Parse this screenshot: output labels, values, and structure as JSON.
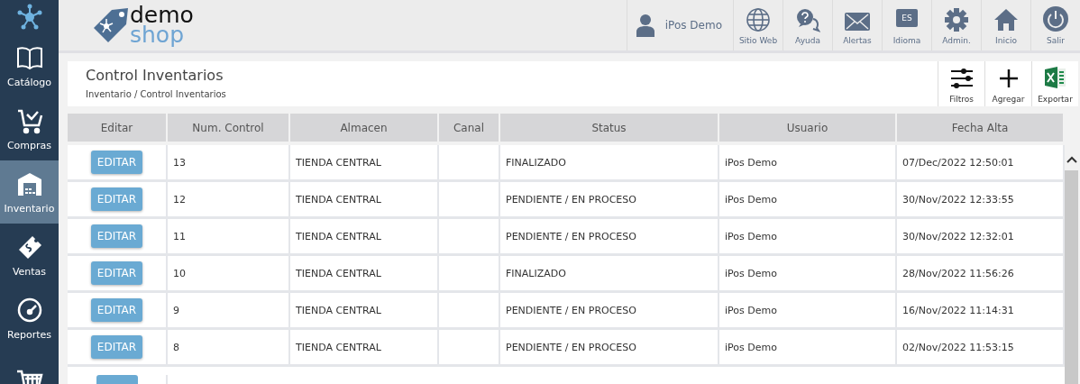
{
  "sidebar": {
    "items": [
      {
        "kind": "catalog",
        "label": "Catálogo",
        "selected": false
      },
      {
        "kind": "purchases",
        "label": "Compras",
        "selected": false
      },
      {
        "kind": "inventory",
        "label": "Inventario",
        "selected": true
      },
      {
        "kind": "sales",
        "label": "Ventas",
        "selected": false
      },
      {
        "kind": "reports",
        "label": "Reportes",
        "selected": false
      },
      {
        "kind": "cart",
        "selected": false
      }
    ]
  },
  "logo": {
    "word_1": "demo",
    "word_2": "shop"
  },
  "user": {
    "name": "iPos Demo"
  },
  "nav": [
    {
      "kind": "web",
      "label": "Sitio Web"
    },
    {
      "kind": "help",
      "label": "Ayuda"
    },
    {
      "kind": "alerts",
      "label": "Alertas"
    },
    {
      "kind": "language",
      "label": "Idioma",
      "badge": "ES"
    },
    {
      "kind": "admin",
      "label": "Admin."
    },
    {
      "kind": "home",
      "label": "Inicio"
    },
    {
      "kind": "exit",
      "label": "Salir"
    }
  ],
  "page": {
    "title": "Control Inventarios",
    "breadcrumb": "Inventario / Control Inventarios"
  },
  "actions": [
    {
      "kind": "filters",
      "label": "Filtros"
    },
    {
      "kind": "add",
      "label": "Agregar"
    },
    {
      "kind": "export",
      "label": "Exportar"
    }
  ],
  "table": {
    "columns": [
      "Editar",
      "Num. Control",
      "Almacen",
      "Canal",
      "Status",
      "Usuario",
      "Fecha Alta"
    ],
    "rows": [
      {
        "button": "EDITAR",
        "num": "13",
        "almacen": "TIENDA CENTRAL",
        "status": "FINALIZADO",
        "usuario": "iPos Demo",
        "fecha": "07/Dec/2022 12:50:01"
      },
      {
        "button": "EDITAR",
        "num": "12",
        "almacen": "TIENDA CENTRAL",
        "status": "PENDIENTE / EN PROCESO",
        "usuario": "iPos Demo",
        "fecha": "30/Nov/2022 12:33:55"
      },
      {
        "button": "EDITAR",
        "num": "11",
        "almacen": "TIENDA CENTRAL",
        "status": "PENDIENTE / EN PROCESO",
        "usuario": "iPos Demo",
        "fecha": "30/Nov/2022 12:32:01"
      },
      {
        "button": "EDITAR",
        "num": "10",
        "almacen": "TIENDA CENTRAL",
        "status": "FINALIZADO",
        "usuario": "iPos Demo",
        "fecha": "28/Nov/2022 11:56:26"
      },
      {
        "button": "EDITAR",
        "num": "9",
        "almacen": "TIENDA CENTRAL",
        "status": "PENDIENTE / EN PROCESO",
        "usuario": "iPos Demo",
        "fecha": "16/Nov/2022 11:14:31"
      },
      {
        "button": "EDITAR",
        "num": "8",
        "almacen": "TIENDA CENTRAL",
        "status": "PENDIENTE / EN PROCESO",
        "usuario": "iPos Demo",
        "fecha": "02/Nov/2022 11:53:15"
      }
    ],
    "next_row_cut_off": true
  }
}
